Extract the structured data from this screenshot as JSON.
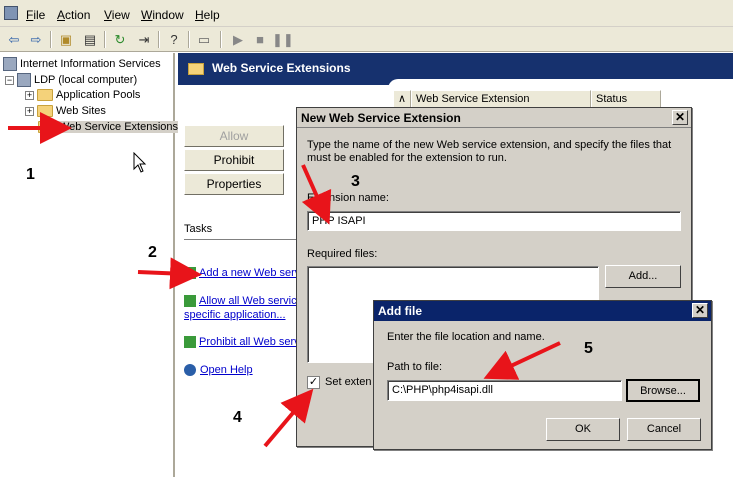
{
  "menu": {
    "items": [
      {
        "label": "File",
        "u": "F",
        "rest": "ile"
      },
      {
        "label": "Action",
        "u": "A",
        "rest": "ction"
      },
      {
        "label": "View",
        "u": "V",
        "rest": "iew"
      },
      {
        "label": "Window",
        "u": "W",
        "rest": "indow"
      },
      {
        "label": "Help",
        "u": "H",
        "rest": "elp"
      }
    ]
  },
  "tree": {
    "root": "Internet Information Services",
    "computer": "LDP (local computer)",
    "items": [
      "Application Pools",
      "Web Sites",
      "Web Service Extensions"
    ]
  },
  "pane": {
    "title": "Web Service Extensions",
    "buttons": {
      "allow": "Allow",
      "prohibit": "Prohibit",
      "properties": "Properties"
    },
    "tasks_label": "Tasks",
    "links": {
      "add": "Add a new Web serv",
      "allow_all_1": "Allow all Web service",
      "allow_all_2": "specific application...",
      "prohibit_all": "Prohibit all Web serv",
      "help": "Open Help"
    },
    "columns": [
      "Web Service Extension",
      "Status"
    ]
  },
  "new_ext_dialog": {
    "title": "New Web Service Extension",
    "description": "Type the name of the new Web service extension, and specify the files that must be enabled for the extension to run.",
    "name_label": "Extension name:",
    "name_value": "PHP ISAPI",
    "required_label": "Required files:",
    "add_button": "Add...",
    "checkbox_label": "Set exten"
  },
  "add_file_dialog": {
    "title": "Add file",
    "description": "Enter the file location and name.",
    "path_label": "Path to file:",
    "path_value": "C:\\PHP\\php4isapi.dll",
    "browse_button": "Browse...",
    "ok_button": "OK",
    "cancel_button": "Cancel"
  },
  "annotations": [
    "1",
    "2",
    "3",
    "4",
    "5"
  ],
  "colors": {
    "arrow": "#e8141a",
    "header": "#16316e",
    "dialog_title": "#0a246a",
    "inactive_title": "#808080"
  }
}
